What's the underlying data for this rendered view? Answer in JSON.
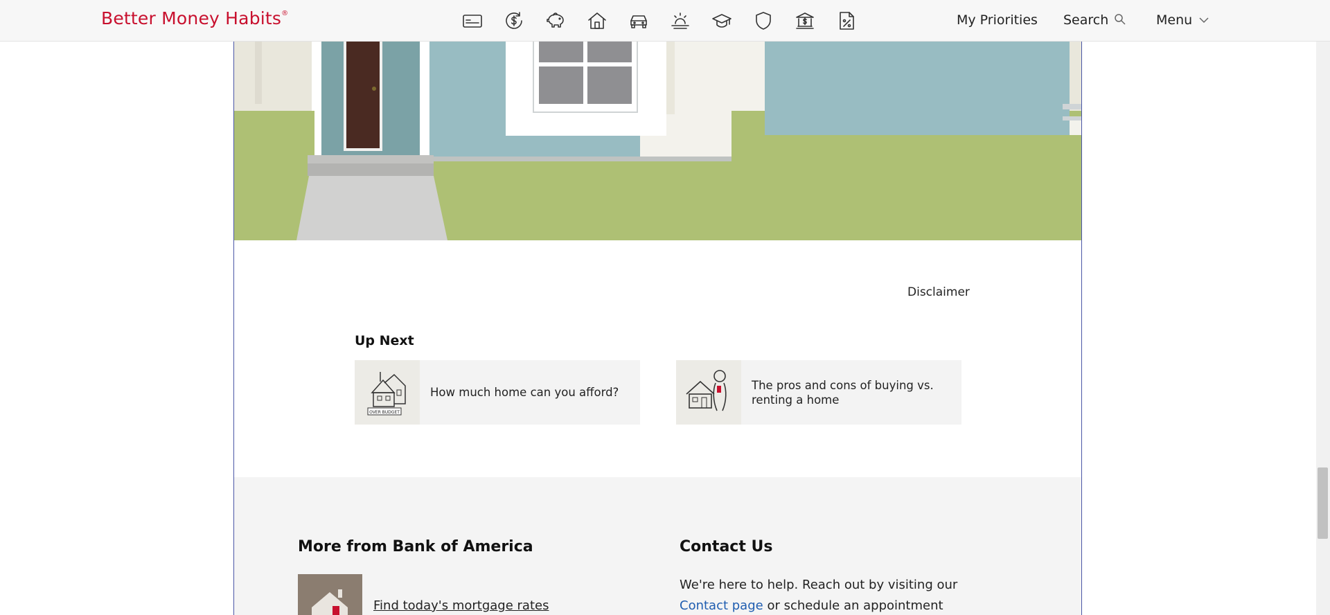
{
  "header": {
    "brand": "Better Money Habits",
    "brand_mark": "®",
    "nav_icons": [
      "credit-card-icon",
      "dollar-transfer-icon",
      "piggy-bank-icon",
      "house-icon",
      "car-icon",
      "sunset-icon",
      "graduation-cap-icon",
      "shield-icon",
      "bank-icon",
      "tax-document-icon"
    ],
    "my_priorities": "My Priorities",
    "search": "Search",
    "menu": "Menu"
  },
  "content": {
    "disclaimer": "Disclaimer",
    "up_next_title": "Up Next",
    "cards": [
      {
        "label": "How much home can you afford?",
        "thumb_caption": "OVER BUDGET"
      },
      {
        "label": "The pros and cons of buying vs. renting a home"
      }
    ]
  },
  "footer": {
    "more_title": "More from Bank of America",
    "mortgage_link": "Find today's mortgage rates",
    "contact_title": "Contact Us",
    "contact_text_1": "We're here to help. Reach out by visiting our",
    "contact_link": "Contact page",
    "contact_text_2": " or schedule an appointment today."
  },
  "colors": {
    "brand": "#c8102e",
    "frame_border": "#4a56a6",
    "link_blue": "#1f5db0",
    "house_blue": "#98bcc2",
    "lawn_green": "#aec074",
    "door_brown": "#4a2a22"
  }
}
